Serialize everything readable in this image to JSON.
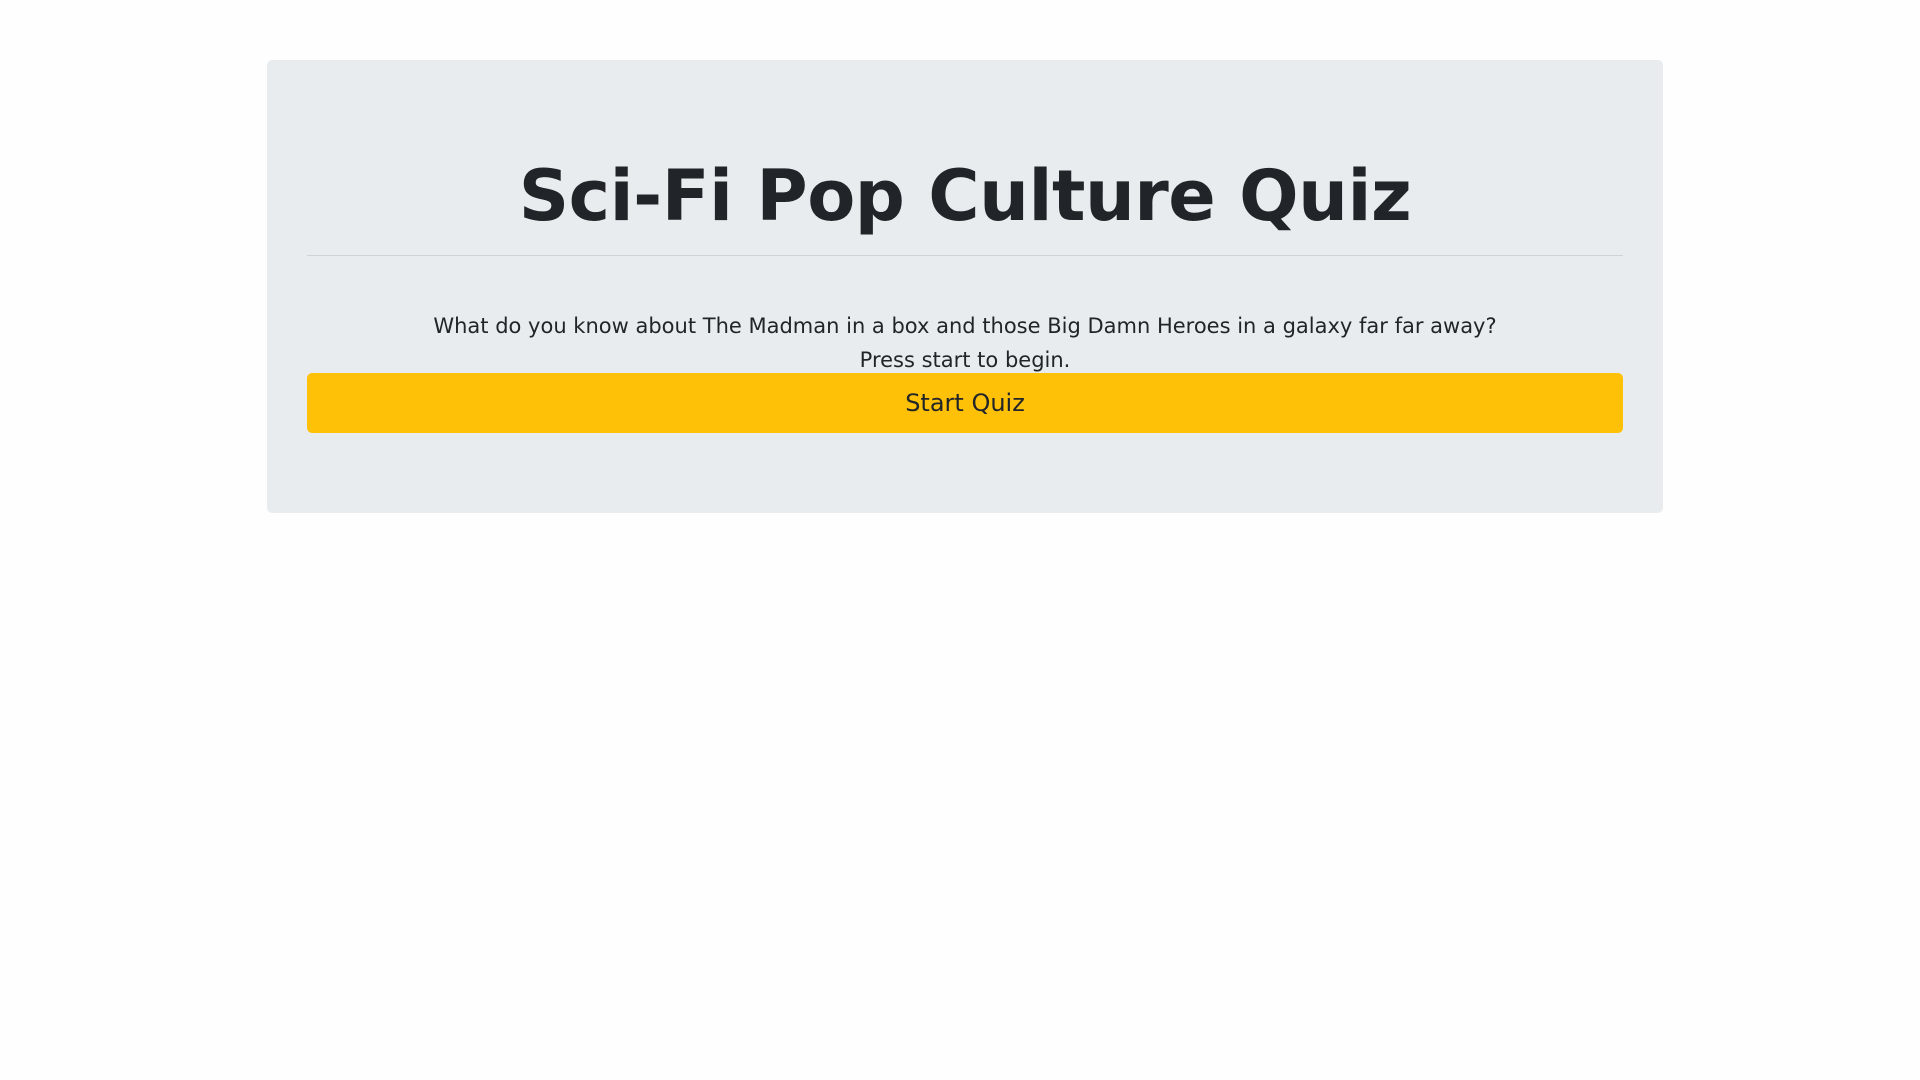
{
  "quiz": {
    "title": "Sci-Fi Pop Culture Quiz",
    "intro_line1": "What do you know about The Madman in a box and those Big Damn Heroes in a galaxy far far away?",
    "intro_line2": "Press start to begin.",
    "start_label": "Start Quiz"
  },
  "colors": {
    "page_background": "#fefefe",
    "panel_background": "#e9ecef",
    "text": "#212529",
    "button_accent": "#ffc107"
  }
}
